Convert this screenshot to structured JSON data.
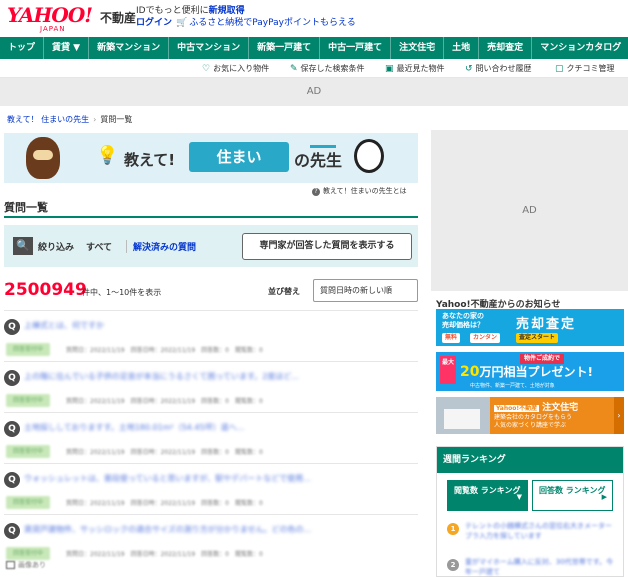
{
  "header": {
    "logo": "YAHOO!",
    "logo_sub": "JAPAN",
    "brand": "不動産",
    "id_text": "IDでもっと便利に",
    "register": "新規取得",
    "login": "ログイン",
    "cart_icon": "cart-icon",
    "promo": "ふるさと納税でPayPayポイントもらえる"
  },
  "nav": {
    "items": [
      {
        "label": "トップ"
      },
      {
        "label": "賃貸 ▼"
      },
      {
        "label": "新築マンション"
      },
      {
        "label": "中古マンション"
      },
      {
        "label": "新築一戸建て"
      },
      {
        "label": "中古一戸建て"
      },
      {
        "label": "注文住宅"
      },
      {
        "label": "土地"
      },
      {
        "label": "売却査定"
      },
      {
        "label": "マンションカタログ"
      }
    ]
  },
  "subnav": {
    "favorites": "お気に入り物件",
    "saved_search": "保存した検索条件",
    "recent": "最近見た物件",
    "inquiries": "問い合わせ履歴",
    "kuchikomi": "クチコミ管理"
  },
  "ads": {
    "top": "AD",
    "side": "AD"
  },
  "breadcrumb": {
    "item1": "教えて！ 住まいの先生",
    "current": "質問一覧"
  },
  "banner": {
    "oshiete": "教えて!",
    "sumai": "住まい",
    "no": "の",
    "sensei": "先生",
    "link": "教えて！住まいの先生とは"
  },
  "list": {
    "heading": "質問一覧",
    "filter_label": "絞り込み",
    "filter_all": "すべて",
    "filter_solved": "解決済みの質問",
    "expert_button": "専門家が回答した質問を表示する",
    "count": "2500949",
    "count_text": "件中、1〜10件を表示",
    "sort_label": "並び替え",
    "sort_value": "質問日時の新しい順",
    "items": [
      {
        "title": "上棟式とは、何ですか",
        "badge": "回答受付中",
        "meta": "質問日：2022/11/19　回答日時：2022/11/19　回答数：0　閲覧数：0"
      },
      {
        "title": "上の階に住んでいる子供の足音が本当にうるさくて困っています。2度ほど...",
        "badge": "回答受付中",
        "meta": "質問日：2022/11/19　回答日時：2022/11/19　回答数：0　閲覧数：0"
      },
      {
        "title": "土地探ししておりますす。土地180.01m²（54.45坪）道へ...",
        "badge": "回答受付中",
        "meta": "質問日：2022/11/19　回答日時：2022/11/19　回答数：0　閲覧数：0"
      },
      {
        "title": "ウォッシュレットは、普段使っていると思いますが、駅やデパートなどで使用...",
        "badge": "回答受付中",
        "meta": "質問日：2022/11/19　回答日時：2022/11/19　回答数：0　閲覧数：0"
      },
      {
        "title": "賃貸戸建物件、サッシロックの適合サイズの測り方が分かりません。どの色の...",
        "badge": "回答受付中",
        "meta": "質問日：2022/11/19　回答日時：2022/11/19　回答数：0　閲覧数：0"
      }
    ],
    "more": "画像あり"
  },
  "side": {
    "news_heading": "Yahoo!不動産からのお知らせ",
    "promo_a": {
      "line1": "あなたの家の",
      "line2": "売却価格は？",
      "title": "売却査定",
      "pill1": "無料",
      "pill2": "カンタン",
      "pill3": "査定スタート"
    },
    "promo_b": {
      "small": "最大",
      "tag": "物件ご成約で",
      "amount": "20",
      "unit": "万円相当プレゼント!",
      "sub": "中古物件、新築一戸建て、土地が対象"
    },
    "promo_c": {
      "tag": "Yahoo!不動産",
      "title": "注文住宅",
      "line1": "建築会社のカタログをもらう",
      "line2": "人気の家づくり講座で学ぶ"
    },
    "ranking": {
      "heading": "週間ランキング",
      "tab1": "閲覧数 ランキング",
      "tab2": "回答数 ランキング",
      "items": [
        {
          "rank": "1",
          "text": "テレントの小銭横式さんの窓位右大きメーターブラ入力を探しています"
        },
        {
          "rank": "2",
          "text": "童がマイホーム購入に反対、30代世帯です。今年一戸建て"
        }
      ]
    }
  },
  "colors": {
    "brand_green": "#00856c",
    "yahoo_red": "#ff0033",
    "link_blue": "#0033cc"
  }
}
